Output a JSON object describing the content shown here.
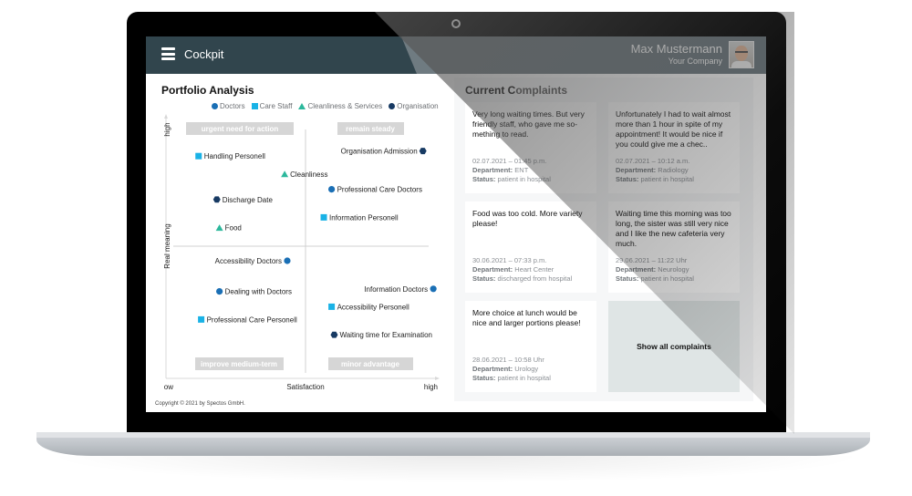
{
  "header": {
    "app_title": "Cockpit",
    "menu_icon": "hamburger-menu-icon",
    "user_name": "Max Mustermann",
    "user_company": "Your Company",
    "avatar_icon": "user-avatar"
  },
  "portfolio": {
    "title": "Portfolio Analysis",
    "legend": [
      {
        "label": "Doctors",
        "shape": "circle",
        "color": "#1a6fb5"
      },
      {
        "label": "Care Staff",
        "shape": "square",
        "color": "#19b2e6"
      },
      {
        "label": "Cleanliness & Services",
        "shape": "triangle",
        "color": "#2cb89c"
      },
      {
        "label": "Organisation",
        "shape": "hexagon",
        "color": "#173a63"
      }
    ],
    "copyright": "Copyright © 2021 by Spectos GmbH."
  },
  "chart_data": {
    "type": "scatter",
    "title": "Portfolio Analysis",
    "xlabel": "Satisfaction",
    "ylabel": "Real meaning",
    "x_ticks": [
      "low",
      "high"
    ],
    "y_ticks": [
      "high"
    ],
    "xlim": [
      0,
      100
    ],
    "ylim": [
      0,
      100
    ],
    "grid": false,
    "legend_position": "top",
    "quadrants": [
      {
        "label": "urgent need for action",
        "position": "top-left"
      },
      {
        "label": "remain steady",
        "position": "top-right"
      },
      {
        "label": "improve medium-term",
        "position": "bottom-left"
      },
      {
        "label": "minor advantage",
        "position": "bottom-right"
      }
    ],
    "points": [
      {
        "label": "Handling Personell",
        "series": "Care Staff",
        "x": 9,
        "y": 86,
        "label_side": "right"
      },
      {
        "label": "Cleanliness",
        "series": "Cleanliness & Services",
        "x": 42,
        "y": 79,
        "label_side": "right"
      },
      {
        "label": "Discharge Date",
        "series": "Organisation",
        "x": 16,
        "y": 69,
        "label_side": "right"
      },
      {
        "label": "Food",
        "series": "Cleanliness & Services",
        "x": 17,
        "y": 58,
        "label_side": "right"
      },
      {
        "label": "Organisation Admission",
        "series": "Organisation",
        "x": 95,
        "y": 88,
        "label_side": "left"
      },
      {
        "label": "Professional Care Doctors",
        "series": "Doctors",
        "x": 60,
        "y": 73,
        "label_side": "right"
      },
      {
        "label": "Information Personell",
        "series": "Care Staff",
        "x": 57,
        "y": 62,
        "label_side": "right"
      },
      {
        "label": "Accessibility Doctors",
        "series": "Doctors",
        "x": 43,
        "y": 45,
        "label_side": "left"
      },
      {
        "label": "Dealing with Doctors",
        "series": "Doctors",
        "x": 17,
        "y": 33,
        "label_side": "right"
      },
      {
        "label": "Professional Care Personell",
        "series": "Care Staff",
        "x": 10,
        "y": 22,
        "label_side": "right"
      },
      {
        "label": "Information Doctors",
        "series": "Doctors",
        "x": 99,
        "y": 34,
        "label_side": "left"
      },
      {
        "label": "Accessibility Personell",
        "series": "Care Staff",
        "x": 60,
        "y": 27,
        "label_side": "right"
      },
      {
        "label": "Waiting time for Examination",
        "series": "Organisation",
        "x": 61,
        "y": 16,
        "label_side": "right"
      }
    ]
  },
  "complaints": {
    "title_bold": "Current C",
    "title_rest": "omplaints",
    "items": [
      {
        "text": "Very long waiting times. But very friendly staff, who gave me so-mething to read.",
        "datetime": "02.07.2021 – 01:45 p.m.",
        "department_label": "Department:",
        "department": "ENT",
        "status_label": "Status:",
        "status": "patient in hospital"
      },
      {
        "text": "Unfortunately I had to wait almost more than 1 hour in spite of my appointment! It would be nice if you could give me a chec..",
        "datetime": "02.07.2021 – 10:12 a.m.",
        "department_label": "Department:",
        "department": "Radiology",
        "status_label": "Status:",
        "status": "patient in hospital"
      },
      {
        "text": "Food was too cold. More variety please!",
        "datetime": "30.06.2021 – 07:33 p.m.",
        "department_label": "Department:",
        "department": "Heart Center",
        "status_label": "Status:",
        "status": "discharged from hospital"
      },
      {
        "text": "Waiting time this morning was too long, the sister was still very nice and I like the new cafeteria very much.",
        "datetime": "29.06.2021 – 11:22 Uhr",
        "department_label": "Department:",
        "department": "Neurology",
        "status_label": "Status:",
        "status": "patient in hospital"
      },
      {
        "text": "More choice at lunch would be nice and larger portions please!",
        "datetime": "28.06.2021 – 10:58 Uhr",
        "department_label": "Department:",
        "department": "Urology",
        "status_label": "Status:",
        "status": "patient in hospital"
      }
    ],
    "show_all_label": "Show all complaints"
  }
}
